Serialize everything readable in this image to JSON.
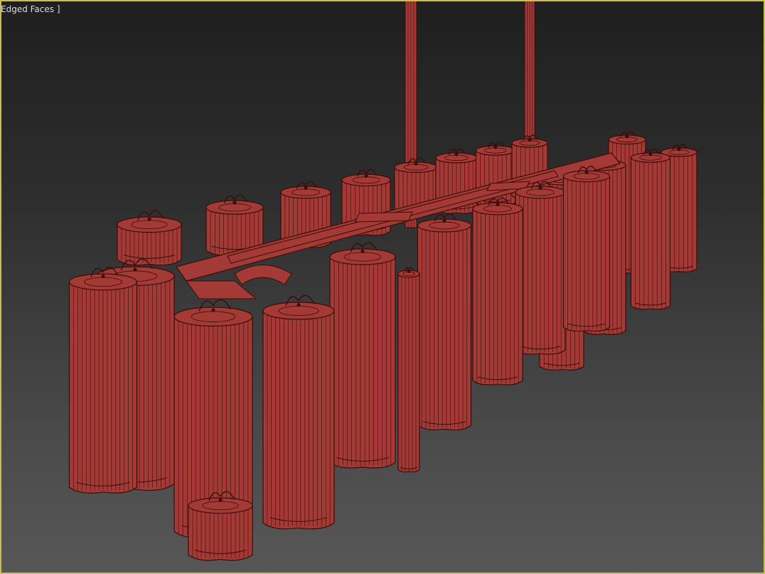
{
  "viewport": {
    "label": "Edged Faces ]",
    "border_color": "#c9c046",
    "background_top": "#1f1f1f",
    "background_bottom": "#575757"
  },
  "model": {
    "fill_color": "#a33a35",
    "edge_color": "#3a0d0b"
  }
}
